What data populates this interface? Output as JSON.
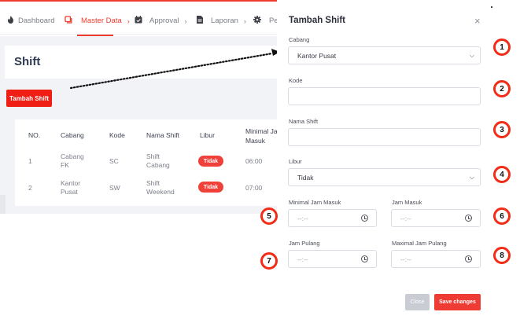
{
  "nav": {
    "items": [
      {
        "label": "Dashboard",
        "icon": "fire-icon"
      },
      {
        "label": "Master Data",
        "icon": "copy-icon",
        "active": true
      },
      {
        "label": "Approval",
        "icon": "calendar-check-icon"
      },
      {
        "label": "Laporan",
        "icon": "file-icon"
      },
      {
        "label": "Pen",
        "icon": "gear-icon"
      }
    ],
    "accent_color": "#ef3b2d"
  },
  "page": {
    "title": "Shift",
    "add_button": "Tambah Shift"
  },
  "table": {
    "headers": [
      "NO.",
      "Cabang",
      "Kode",
      "Nama Shift",
      "Libur",
      "Minimal Jam",
      "Masuk"
    ],
    "rows": [
      {
        "no": "1",
        "cabang": [
          "Cabang",
          "FK"
        ],
        "kode": "SC",
        "nama": [
          "Shift",
          "Cabang"
        ],
        "libur": "Tidak",
        "minimal": "06:00"
      },
      {
        "no": "2",
        "cabang": [
          "Kantor",
          "Pusat"
        ],
        "kode": "SW",
        "nama": [
          "Shift",
          "Weekend"
        ],
        "libur": "Tidak",
        "minimal": "07:00"
      }
    ]
  },
  "modal": {
    "title": "Tambah Shift",
    "close_glyph": "×",
    "fields": {
      "cabang": {
        "label": "Cabang",
        "value": "Kantor Pusat"
      },
      "kode": {
        "label": "Kode",
        "value": ""
      },
      "nama_shift": {
        "label": "Nama Shift",
        "value": ""
      },
      "libur": {
        "label": "Libur",
        "value": "Tidak"
      },
      "minimal_jam_masuk": {
        "label": "Minimal Jam Masuk",
        "value": "--:--"
      },
      "jam_masuk": {
        "label": "Jam Masuk",
        "value": "--:--"
      },
      "jam_pulang": {
        "label": "Jam Pulang",
        "value": "--:--"
      },
      "maximal_jam_pulang": {
        "label": "Maximal Jam Pulang",
        "value": "--:--"
      }
    },
    "close_button": "Close",
    "save_button": "Save changes"
  },
  "markers": [
    "1",
    "2",
    "3",
    "4",
    "5",
    "6",
    "7",
    "8"
  ],
  "colors": {
    "accent": "#ef3b2d",
    "marker_ring": "#f22c16",
    "badge": "#f0403a"
  }
}
